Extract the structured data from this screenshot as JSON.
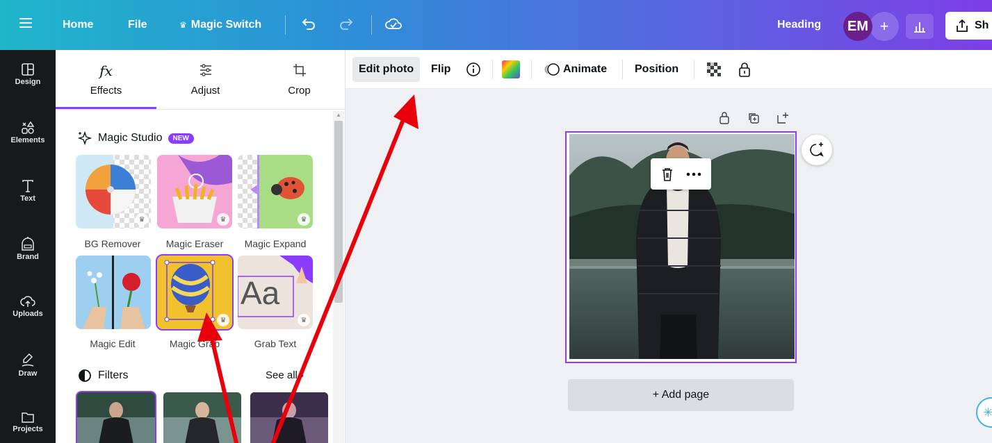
{
  "topbar": {
    "home": "Home",
    "file": "File",
    "magic_switch": "Magic Switch",
    "heading": "Heading",
    "avatar_initials": "EM",
    "share": "Sh"
  },
  "rail": [
    {
      "label": "Design",
      "icon": "layout-icon"
    },
    {
      "label": "Elements",
      "icon": "shapes-icon"
    },
    {
      "label": "Text",
      "icon": "text-icon"
    },
    {
      "label": "Brand",
      "icon": "brand-icon"
    },
    {
      "label": "Uploads",
      "icon": "cloud-upload-icon"
    },
    {
      "label": "Draw",
      "icon": "draw-icon"
    },
    {
      "label": "Projects",
      "icon": "folder-icon"
    }
  ],
  "panel": {
    "tabs": [
      {
        "label": "Effects",
        "icon": "fx"
      },
      {
        "label": "Adjust",
        "icon": "sliders-icon"
      },
      {
        "label": "Crop",
        "icon": "crop-icon"
      }
    ],
    "magic_studio": {
      "title": "Magic Studio",
      "badge": "NEW",
      "tiles": [
        {
          "label": "BG Remover"
        },
        {
          "label": "Magic Eraser"
        },
        {
          "label": "Magic Expand"
        },
        {
          "label": "Magic Edit"
        },
        {
          "label": "Magic Grab"
        },
        {
          "label": "Grab Text"
        }
      ]
    },
    "filters": {
      "title": "Filters",
      "see_all": "See all"
    }
  },
  "context_toolbar": {
    "edit_photo": "Edit photo",
    "flip": "Flip",
    "animate": "Animate",
    "position": "Position"
  },
  "canvas": {
    "add_page": "+ Add page"
  },
  "colors": {
    "accent": "#8b3dff",
    "annotation": "#e8000b",
    "rail_bg": "#18191b"
  }
}
